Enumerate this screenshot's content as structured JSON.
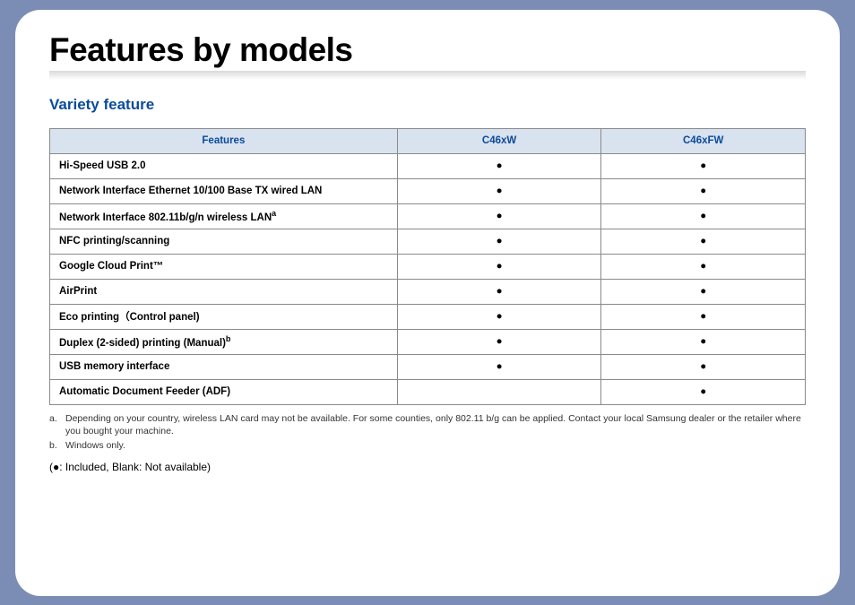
{
  "title": "Features by models",
  "section": "Variety feature",
  "table": {
    "headers": [
      "Features",
      "C46xW",
      "C46xFW"
    ],
    "rows": [
      {
        "label": "Hi-Speed USB 2.0",
        "note": "",
        "col1": "●",
        "col2": "●"
      },
      {
        "label": "Network Interface Ethernet 10/100 Base TX wired LAN",
        "note": "",
        "col1": "●",
        "col2": "●"
      },
      {
        "label": "Network Interface 802.11b/g/n wireless LAN",
        "note": "a",
        "col1": "●",
        "col2": "●"
      },
      {
        "label": "NFC printing/scanning",
        "note": "",
        "col1": "●",
        "col2": "●"
      },
      {
        "label": "Google Cloud Print™",
        "note": "",
        "col1": "●",
        "col2": "●"
      },
      {
        "label": "AirPrint",
        "note": "",
        "col1": "●",
        "col2": "●"
      },
      {
        "label": "Eco printing（Control panel)",
        "note": "",
        "col1": "●",
        "col2": "●"
      },
      {
        "label": "Duplex (2-sided) printing (Manual)",
        "note": "b",
        "col1": "●",
        "col2": "●"
      },
      {
        "label": "USB memory interface",
        "note": "",
        "col1": "●",
        "col2": "●"
      },
      {
        "label": "Automatic Document Feeder (ADF)",
        "note": "",
        "col1": "",
        "col2": "●"
      }
    ]
  },
  "footnotes": [
    {
      "letter": "a.",
      "text": "Depending on your country, wireless LAN card may not be available. For some counties, only 802.11 b/g can be applied. Contact your local Samsung dealer or the retailer where you bought your machine."
    },
    {
      "letter": "b.",
      "text": "Windows only."
    }
  ],
  "legend": "(●: Included, Blank: Not available)"
}
